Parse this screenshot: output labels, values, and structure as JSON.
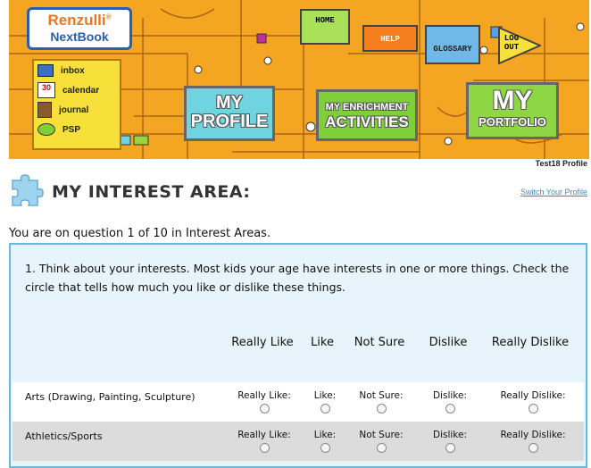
{
  "banner": {
    "logo_line1": "Renzulli",
    "logo_reg": "®",
    "logo_line2": "NextBook",
    "quick_links": [
      {
        "label": "inbox",
        "icon": "mail-icon"
      },
      {
        "label": "calendar",
        "icon": "calendar-icon",
        "icon_text": "30"
      },
      {
        "label": "journal",
        "icon": "journal-icon"
      },
      {
        "label": "PSP",
        "icon": "speech-bubble-icon"
      }
    ],
    "nav": {
      "home": "HOME",
      "help": "HELP",
      "glossary": "GLOSSARY",
      "logout_l1": "LOG",
      "logout_l2": "OUT"
    },
    "big_nav": {
      "profile_l1": "MY",
      "profile_l2": "PROFILE",
      "enrich_l1": "MY ENRICHMENT",
      "enrich_l2": "ACTIVITIES",
      "portfolio_l1": "MY",
      "portfolio_l2": "PORTFOLIO"
    },
    "colors": {
      "banner_bg": "#f4a623",
      "profile_green": "#9bd33b",
      "enrich_green": "#7fcf3a",
      "portfolio_green": "#8fd645",
      "nav_green": "#a8e05a",
      "help_orange": "#f57f1e",
      "glossary_blue": "#6fb8e8"
    }
  },
  "profile": {
    "name": "Test18 Profile",
    "switch_label": "Switch Your Profile"
  },
  "page": {
    "title": "MY INTEREST AREA:",
    "progress": "You are on question 1 of 10 in Interest Areas."
  },
  "question": {
    "text": "1. Think about your interests. Most kids your age have interests in one or more things. Check the circle that tells how much you like or dislike these things.",
    "columns": [
      "Really Like",
      "Like",
      "Not Sure",
      "Dislike",
      "Really Dislike"
    ],
    "rows": [
      {
        "label": "Arts (Drawing, Painting, Sculpture)",
        "options": [
          "Really Like:",
          "Like:",
          "Not Sure:",
          "Dislike:",
          "Really Dislike:"
        ]
      },
      {
        "label": "Athletics/Sports",
        "options": [
          "Really Like:",
          "Like:",
          "Not Sure:",
          "Dislike:",
          "Really Dislike:"
        ]
      }
    ]
  }
}
